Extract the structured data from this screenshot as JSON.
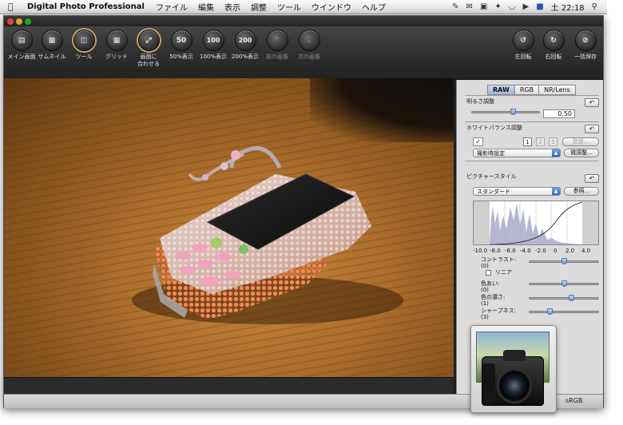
{
  "menubar": {
    "app_name": "Digital Photo Professional",
    "menus": [
      "ファイル",
      "編集",
      "表示",
      "調整",
      "ツール",
      "ウインドウ",
      "ヘルプ"
    ],
    "clock": "土 22:18"
  },
  "toolbar": {
    "left_buttons": [
      {
        "label": "メイン画面",
        "icon": "folder-icon"
      },
      {
        "label": "サムネイル",
        "icon": "thumbnail-icon"
      },
      {
        "label": "ツール",
        "icon": "tool-icon"
      },
      {
        "label": "グリッド",
        "icon": "grid-icon"
      },
      {
        "label": "画面に\n合わせる",
        "icon": "fit-screen-icon"
      },
      {
        "label": "50%表示",
        "glyph": "50"
      },
      {
        "label": "100%表示",
        "glyph": "100"
      },
      {
        "label": "200%表示",
        "glyph": "200"
      },
      {
        "label": "前の画像",
        "icon": "prev-image-icon"
      },
      {
        "label": "次の画像",
        "icon": "next-image-icon"
      }
    ],
    "right_buttons": [
      {
        "label": "左回転",
        "icon": "rotate-left-icon"
      },
      {
        "label": "右回転",
        "icon": "rotate-right-icon"
      },
      {
        "label": "一括保存",
        "icon": "batch-save-icon"
      }
    ]
  },
  "palette": {
    "tabs": [
      "RAW",
      "RGB",
      "NR/Lens"
    ],
    "selected_tab": "RAW",
    "brightness": {
      "title": "明るさ調整",
      "value": "0.50",
      "level": 0.5
    },
    "white_balance": {
      "title": "ホワイトバランス調整",
      "presets": [
        "1",
        "2",
        "3"
      ],
      "register_label": "登録...",
      "mode_value": "撮影時設定",
      "fine_tune_label": "微調整..."
    },
    "picture_style": {
      "title": "ピクチャースタイル",
      "style_value": "スタンダード",
      "browse_label": "参照...",
      "histogram_axis": [
        "-10.0",
        "-8.0",
        "-6.0",
        "-4.0",
        "-2.0",
        "0",
        "2.0",
        "4.0"
      ],
      "params": [
        {
          "label": "コントラスト:",
          "value": "(0)",
          "level": 0.5
        },
        {
          "label": "色あい:",
          "value": "(0)",
          "level": 0.5
        },
        {
          "label": "色の濃さ:",
          "value": "(1)",
          "level": 0.6
        },
        {
          "label": "シャープネス:",
          "value": "(3)",
          "level": 0.33
        }
      ],
      "linear_label": "リニア"
    }
  },
  "bottom_strip": {
    "color_space": "sRGB"
  }
}
